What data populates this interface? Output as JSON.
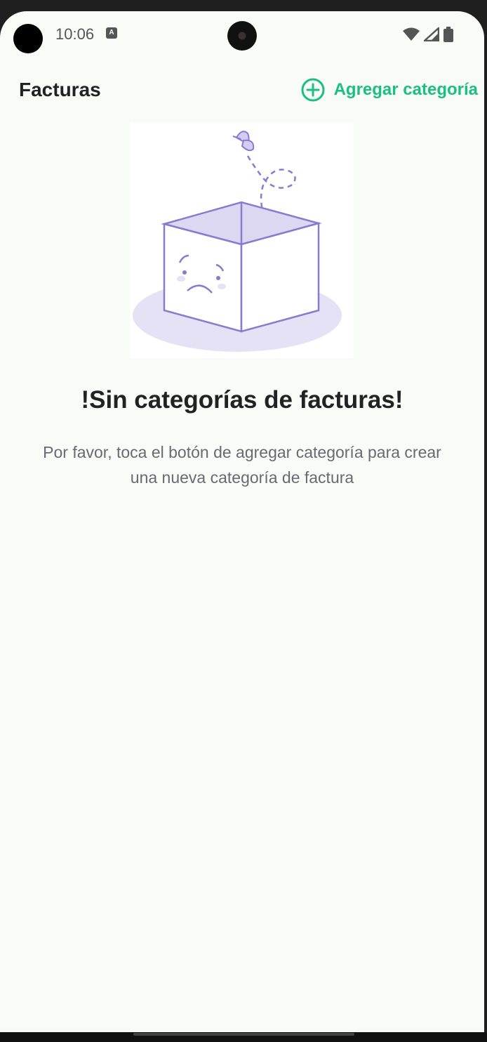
{
  "status_bar": {
    "time": "10:06",
    "notification_icon": "A",
    "icons": [
      "wifi-icon",
      "signal-icon",
      "battery-icon"
    ]
  },
  "appbar": {
    "title": "Facturas",
    "add_button_label": "Agregar categoría",
    "add_button_icon": "plus-circle-icon"
  },
  "empty_state": {
    "illustration": "empty-box-illustration",
    "title": "!Sin categorías de facturas!",
    "message": "Por favor, toca el botón de agregar categoría para crear una nueva categoría de factura"
  },
  "colors": {
    "accent": "#1bbf83",
    "background": "#f9fbf7",
    "illustration_stroke": "#8a7ad0",
    "illustration_fill": "#e6e2f6",
    "title_text": "#222222",
    "body_text": "#666b73"
  }
}
